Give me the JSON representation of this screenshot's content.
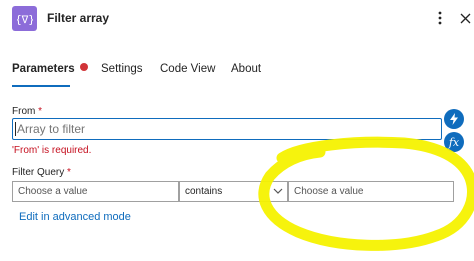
{
  "header": {
    "title": "Filter array",
    "icon": "filter-array-icon",
    "icon_color": "#8c6cd9"
  },
  "tabs": [
    {
      "label": "Parameters",
      "active": true,
      "has_error": true
    },
    {
      "label": "Settings"
    },
    {
      "label": "Code View"
    },
    {
      "label": "About"
    }
  ],
  "from": {
    "label": "From",
    "required_mark": "*",
    "placeholder": "Array to filter",
    "value": "",
    "error": "'From' is required."
  },
  "filter_query": {
    "label": "Filter Query",
    "required_mark": "*",
    "left_placeholder": "Choose a value",
    "operator": "contains",
    "right_placeholder": "Choose a value"
  },
  "edit_link": "Edit in advanced mode",
  "side_buttons": [
    "lightning-icon",
    "fx-icon"
  ],
  "colors": {
    "accent": "#0f6cbd",
    "error": "#c50f1f",
    "highlight": "#f5f200"
  }
}
